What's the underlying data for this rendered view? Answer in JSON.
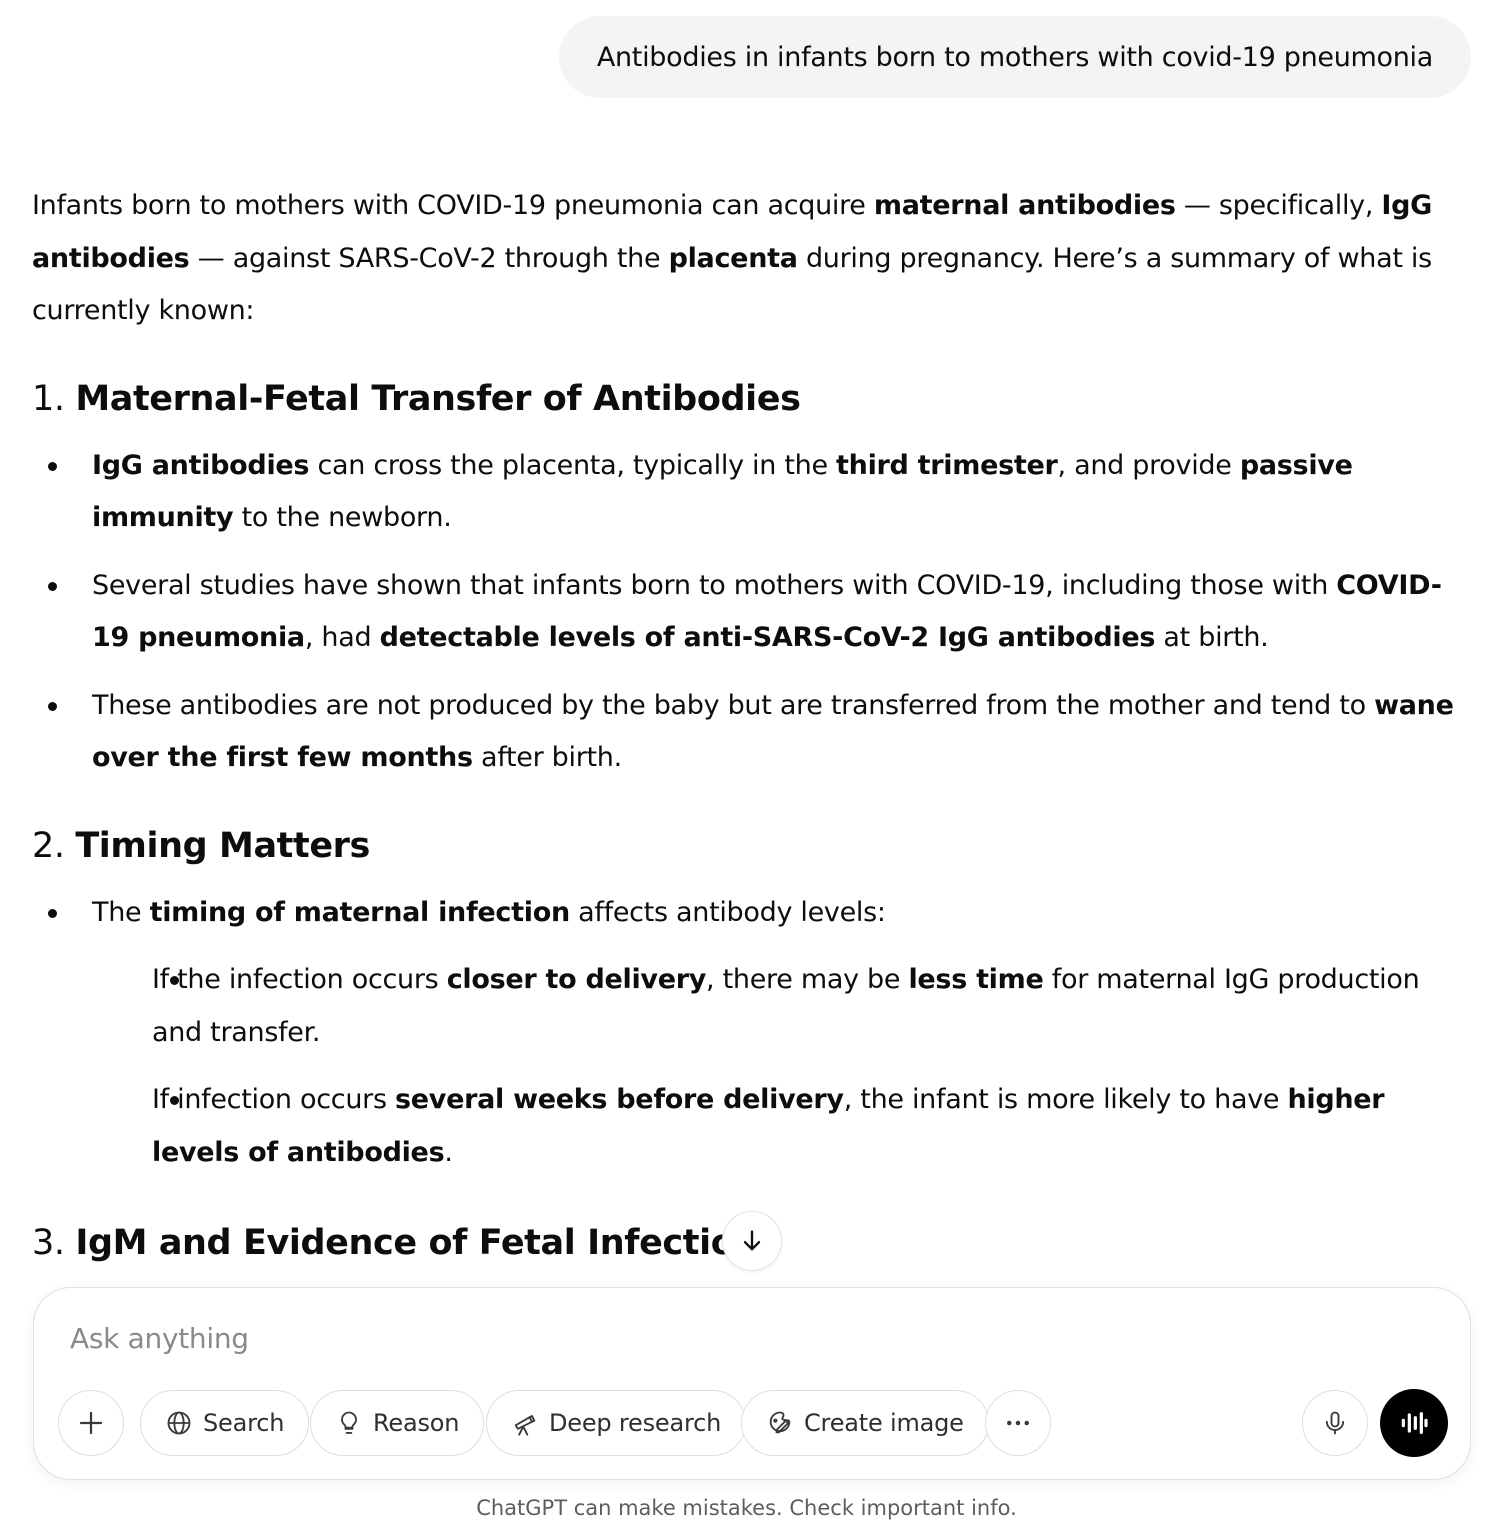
{
  "user_message": "Antibodies in infants born to mothers with covid-19 pneumonia",
  "intro": [
    {
      "t": "Infants born to mothers with COVID-19 pneumonia can acquire "
    },
    {
      "t": "maternal antibodies",
      "b": true
    },
    {
      "t": " — specifically, "
    },
    {
      "t": "IgG antibodies",
      "b": true
    },
    {
      "t": " — against SARS-CoV-2 through the "
    },
    {
      "t": "placenta",
      "b": true
    },
    {
      "t": " during pregnancy. Here’s a summary of what is currently known:"
    }
  ],
  "sections": [
    {
      "num": "1.",
      "title": "Maternal-Fetal Transfer of Antibodies",
      "bullets": [
        {
          "segs": [
            {
              "t": "IgG antibodies",
              "b": true
            },
            {
              "t": " can cross the placenta, typically in the "
            },
            {
              "t": "third trimester",
              "b": true
            },
            {
              "t": ", and provide "
            },
            {
              "t": "passive immunity",
              "b": true
            },
            {
              "t": " to the newborn."
            }
          ]
        },
        {
          "segs": [
            {
              "t": "Several studies have shown that infants born to mothers with COVID-19, including those with "
            },
            {
              "t": "COVID-19 pneumonia",
              "b": true
            },
            {
              "t": ", had "
            },
            {
              "t": "detectable levels of anti-SARS-CoV-2 IgG antibodies",
              "b": true
            },
            {
              "t": " at birth."
            }
          ]
        },
        {
          "segs": [
            {
              "t": "These antibodies are not produced by the baby but are transferred from the mother and tend to "
            },
            {
              "t": "wane over the first few months",
              "b": true
            },
            {
              "t": " after birth."
            }
          ]
        }
      ]
    },
    {
      "num": "2.",
      "title": "Timing Matters",
      "bullets": [
        {
          "segs": [
            {
              "t": "The "
            },
            {
              "t": "timing of maternal infection",
              "b": true
            },
            {
              "t": " affects antibody levels:"
            }
          ],
          "sub": [
            {
              "segs": [
                {
                  "t": "If the infection occurs "
                },
                {
                  "t": "closer to delivery",
                  "b": true
                },
                {
                  "t": ", there may be "
                },
                {
                  "t": "less time",
                  "b": true
                },
                {
                  "t": " for maternal IgG production and transfer."
                }
              ]
            },
            {
              "segs": [
                {
                  "t": "If infection occurs "
                },
                {
                  "t": "several weeks before delivery",
                  "b": true
                },
                {
                  "t": ", the infant is more likely to have "
                },
                {
                  "t": "higher levels of antibodies",
                  "b": true
                },
                {
                  "t": "."
                }
              ]
            }
          ]
        }
      ]
    },
    {
      "num": "3.",
      "title": "IgM and Evidence of Fetal Infection",
      "bullets": []
    }
  ],
  "composer": {
    "placeholder": "Ask anything",
    "tools": {
      "search": "Search",
      "reason": "Reason",
      "deep_research": "Deep research",
      "create_image": "Create image"
    }
  },
  "footer_note": "ChatGPT can make mistakes. Check important info.",
  "icons": {
    "scroll": "arrow-down-icon",
    "add": "plus-icon",
    "search": "globe-icon",
    "reason": "lightbulb-icon",
    "deep_research": "telescope-icon",
    "create_image": "image-brush-icon",
    "more": "ellipsis-icon",
    "mic": "microphone-icon",
    "voice": "voice-waveform-icon"
  },
  "colors": {
    "bubble_bg": "#f4f4f4",
    "text": "#0d0d0d",
    "voice_button": "#000000"
  }
}
